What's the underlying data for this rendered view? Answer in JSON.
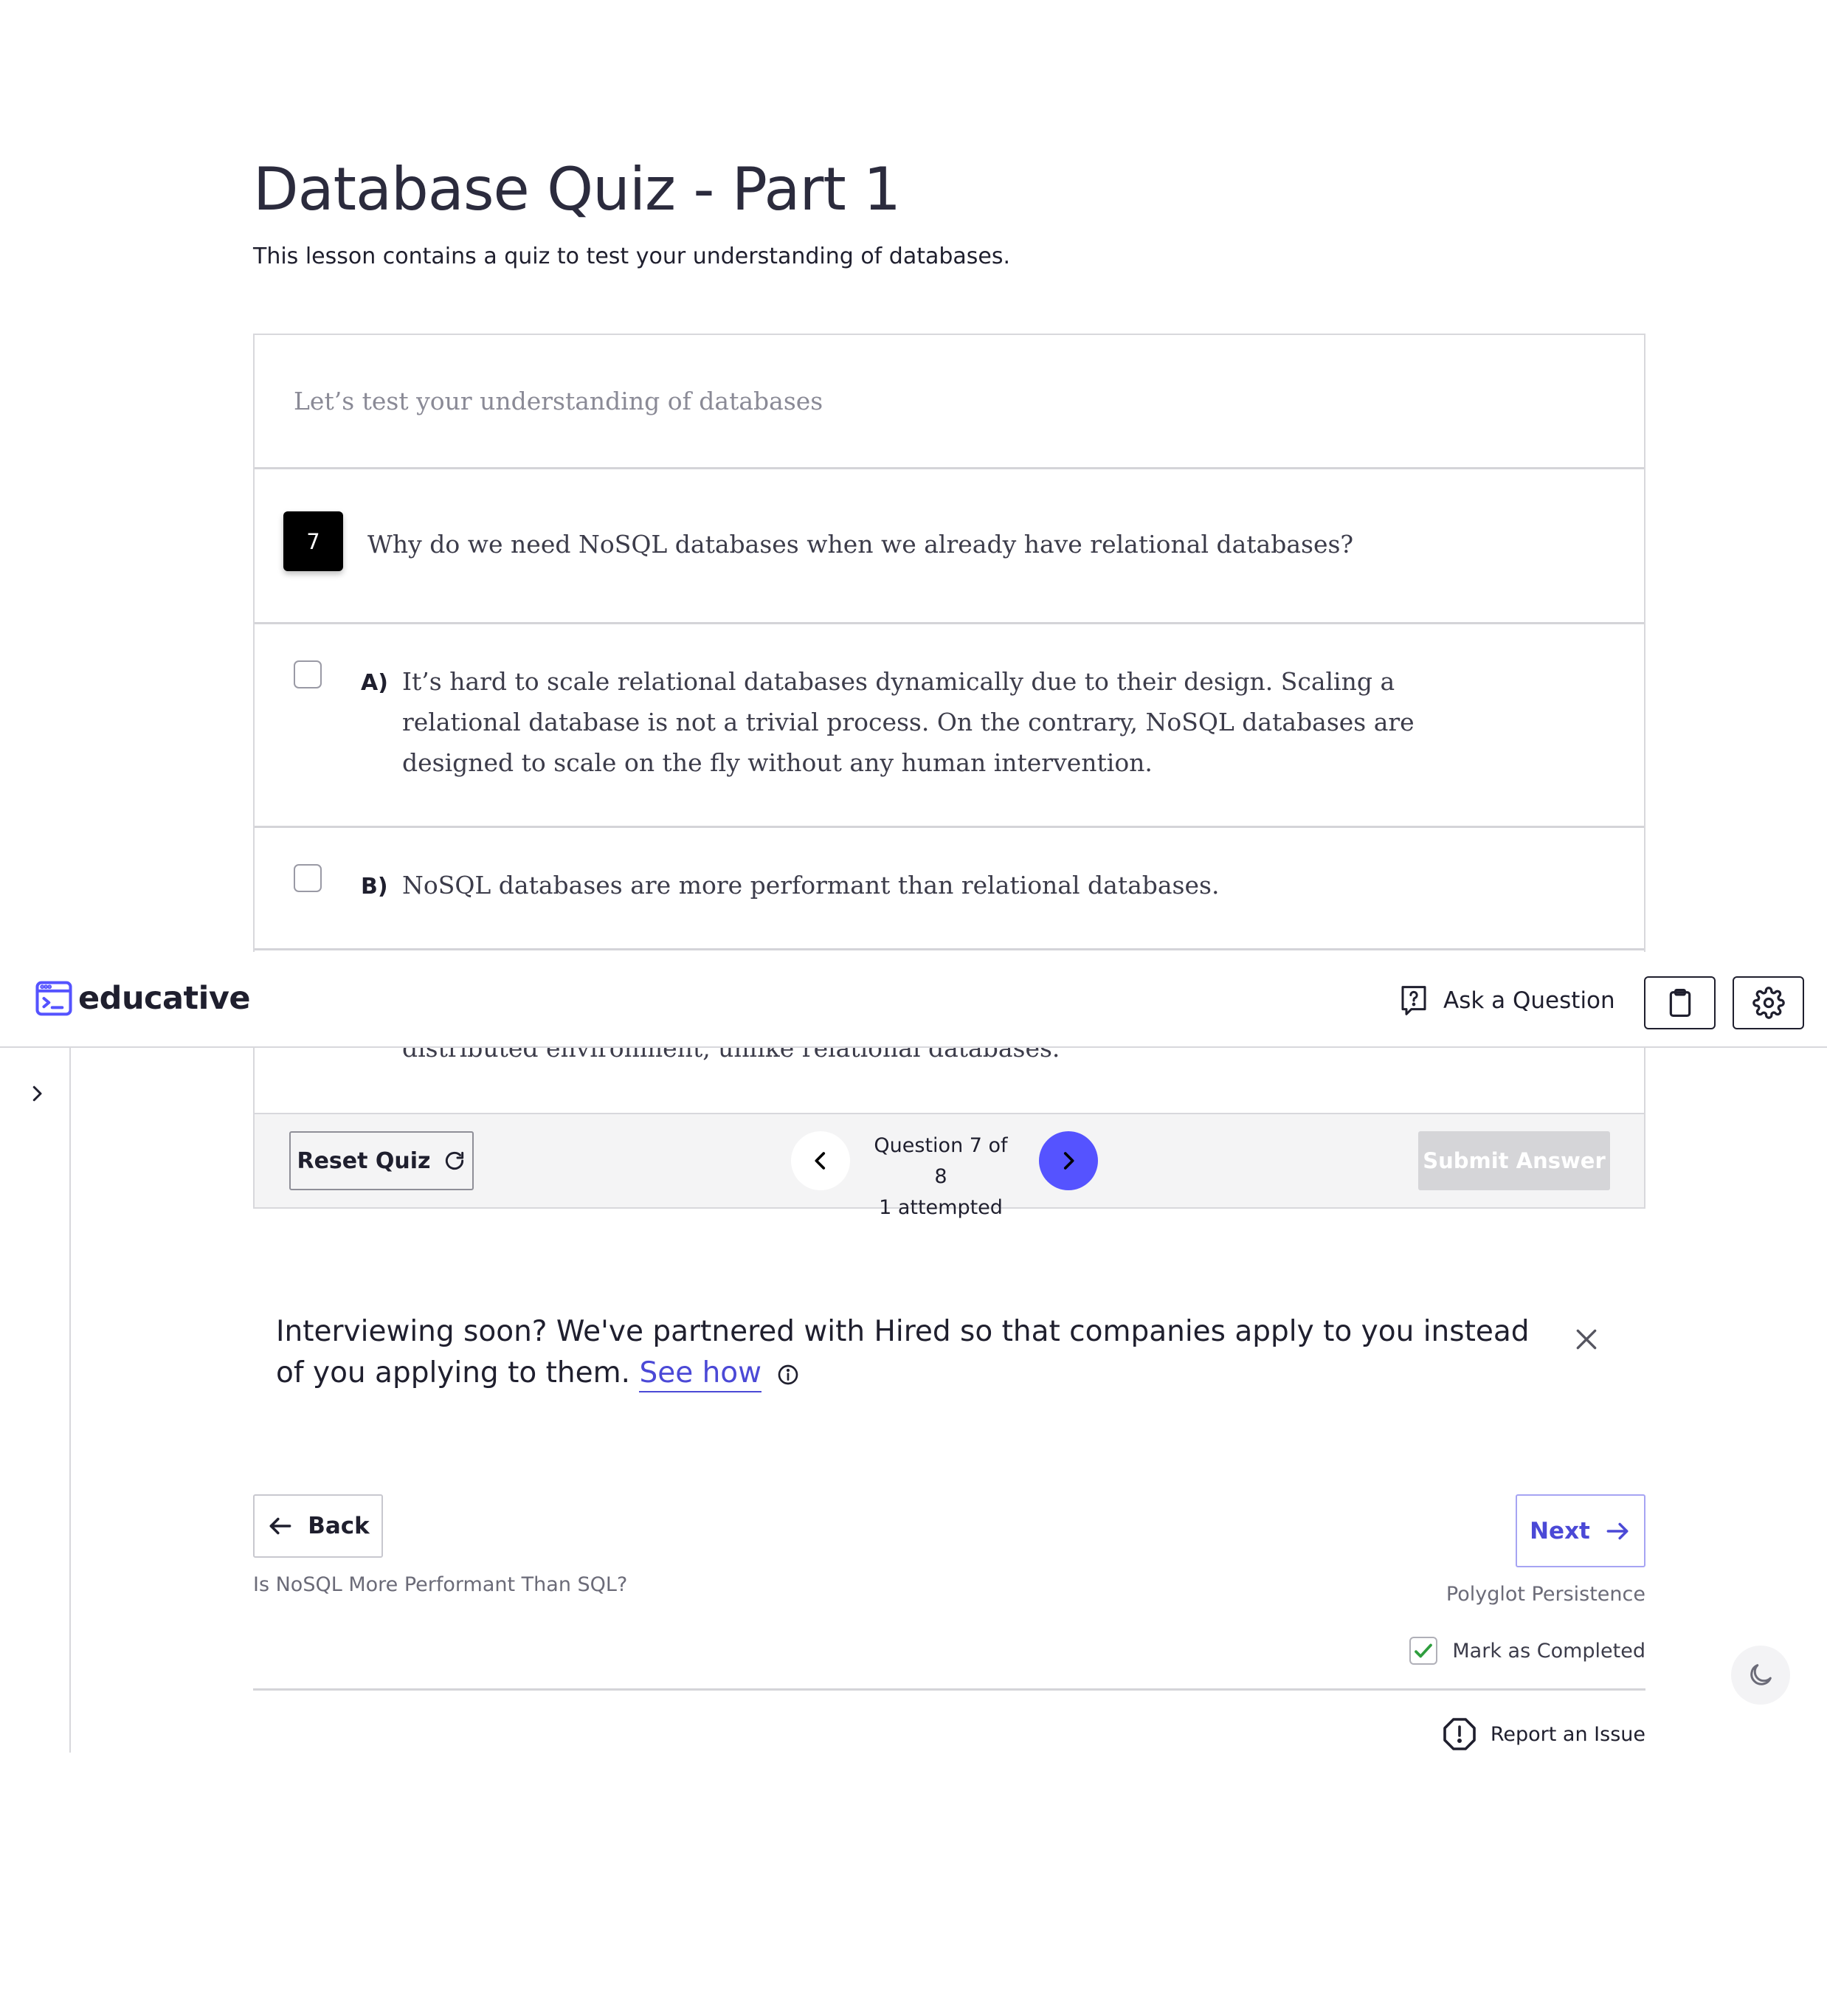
{
  "lesson": {
    "title": "Database Quiz - Part 1",
    "subtitle": "This lesson contains a quiz to test your understanding of databases."
  },
  "quiz": {
    "header": "Let’s test your understanding of databases",
    "question_number": "7",
    "question_text": "Why do we need NoSQL databases when we already have relational databases?",
    "options": [
      {
        "letter": "A)",
        "text": "It’s hard to scale relational databases dynamically due to their design. Scaling a relational database is not a trivial process. On the contrary, NoSQL databases are designed to scale on the fly without any human intervention.",
        "checked": false
      },
      {
        "letter": "B)",
        "text": "NoSQL databases are more performant than relational databases.",
        "checked": false
      }
    ],
    "partially_hidden_text": "distributed environment, unlike relational databases.",
    "reset_label": "Reset Quiz",
    "status_line1": "Question 7 of 8",
    "status_line2": "1 attempted",
    "submit_label": "Submit Answer"
  },
  "topbar": {
    "logo_text": "educative",
    "ask_label": "Ask a Question",
    "icons": [
      "question-box-icon",
      "clipboard-icon",
      "gear-icon"
    ]
  },
  "promo": {
    "text": "Interviewing soon? We've partnered with Hired so that companies apply to you instead of you applying to them.",
    "link": "See how"
  },
  "navigation": {
    "back_label": "Back",
    "back_caption": "Is NoSQL More Performant Than SQL?",
    "next_label": "Next",
    "next_caption": "Polyglot Persistence",
    "mark_completed": "Mark as Completed",
    "mark_checked": true,
    "report_label": "Report an Issue"
  },
  "colors": {
    "accent": "#5553ff",
    "link": "#4b49d6",
    "check_green": "#2e9e3e"
  }
}
